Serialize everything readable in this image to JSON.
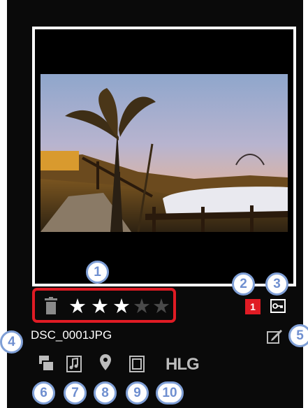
{
  "filename": "DSC_0001JPG",
  "rating": {
    "value": 3,
    "max": 5
  },
  "rank_badge": "1",
  "hdr_label": "HLG",
  "icons": {
    "trash": "trash-icon",
    "protect": "key-protect-icon",
    "edit": "pen-edit-icon",
    "sequence": "stack-icon",
    "voice_memo": "music-note-icon",
    "location": "location-pin-icon",
    "frame": "film-frame-icon"
  },
  "callouts": [
    "1",
    "2",
    "3",
    "4",
    "5",
    "6",
    "7",
    "8",
    "9",
    "10"
  ],
  "colors": {
    "panel": "#0a0a0a",
    "highlight_border": "#e01b24",
    "rank_badge": "#e01b24",
    "callout_border": "#7f9fd6",
    "callout_text": "#6f8fd0",
    "star_on": "#ffffff",
    "star_off": "#4a4a4a",
    "icon_gray": "#bcbcbc"
  }
}
